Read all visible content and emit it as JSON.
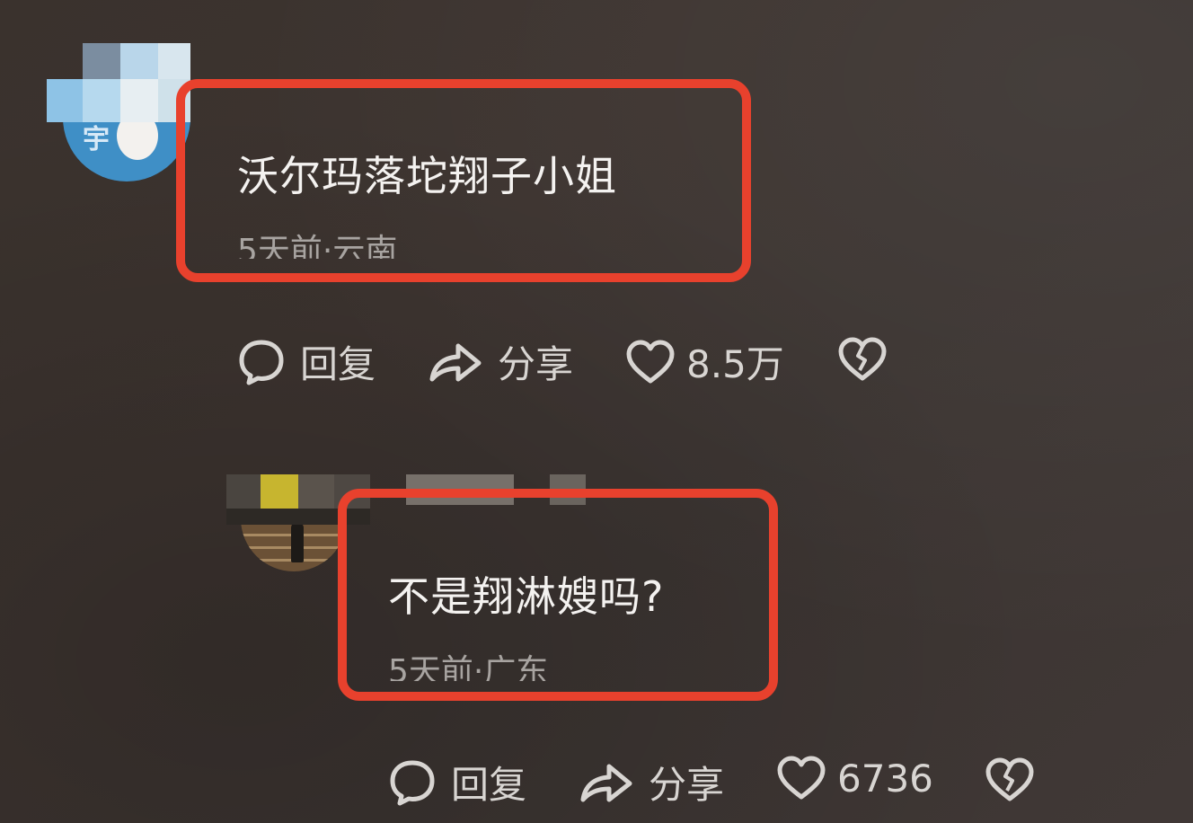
{
  "comments": [
    {
      "text": "沃尔玛落坨翔子小姐",
      "meta": "5天前·云南",
      "actions": {
        "reply_label": "回复",
        "share_label": "分享",
        "like_count": "8.5万"
      }
    },
    {
      "text": "不是翔淋嫂吗?",
      "meta": "5天前·广东",
      "actions": {
        "reply_label": "回复",
        "share_label": "分享",
        "like_count": "6736"
      }
    }
  ],
  "colors": {
    "highlight": "#e8412d",
    "text": "#f4f2f0",
    "meta": "#a8a4a1",
    "icon": "#d8d5d2"
  },
  "icons": [
    "reply-icon",
    "share-icon",
    "heart-icon",
    "broken-heart-icon"
  ]
}
